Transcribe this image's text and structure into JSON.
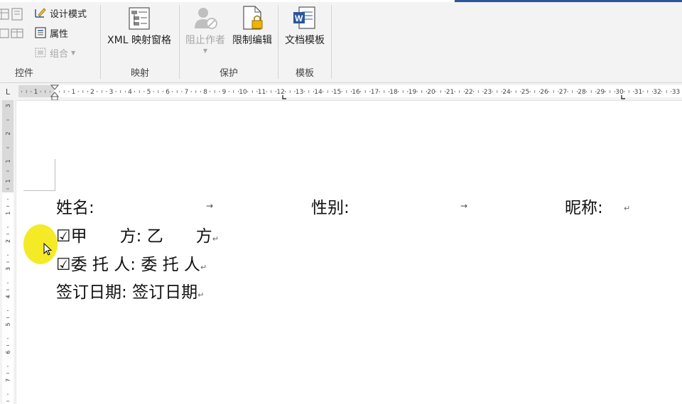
{
  "ribbon": {
    "groups": {
      "controls": {
        "label": "控件",
        "design_mode": "设计模式",
        "properties": "属性",
        "group": "组合"
      },
      "mapping": {
        "label": "映射",
        "xml_mapping_pane": "XML 映射窗格"
      },
      "protect": {
        "label": "保护",
        "block_authors": "阻止作者",
        "restrict_editing": "限制编辑"
      },
      "templates": {
        "label": "模板",
        "document_template": "文档模板"
      }
    }
  },
  "ruler": {
    "corner": "L",
    "h_numbers": [
      "1",
      "1",
      "2",
      "3",
      "4",
      "5",
      "6",
      "7",
      "8",
      "9",
      "10",
      "11",
      "12",
      "13",
      "14",
      "15",
      "16",
      "17",
      "18",
      "19",
      "20",
      "21",
      "22",
      "23",
      "24",
      "25",
      "26",
      "27",
      "28",
      "29",
      "30",
      "31",
      "32",
      "33"
    ],
    "v_numbers_top": [
      "3",
      "2",
      "1",
      "1"
    ],
    "v_numbers_body": [
      "1",
      "2",
      "3",
      "4",
      "5",
      "6",
      "7"
    ]
  },
  "document": {
    "line1": {
      "name_label": "姓名:",
      "gender_label": "性别:",
      "nickname_label": "昵称:"
    },
    "line2": {
      "checkbox": "☑",
      "left": "甲　　方:",
      "right": "乙　　方"
    },
    "line3": {
      "checkbox": "☑",
      "left": "委 托 人:",
      "right": "委 托 人"
    },
    "line4": {
      "left": "签订日期:",
      "right": "签订日期"
    },
    "tab_mark": "→",
    "return_mark": "↵"
  },
  "colors": {
    "accent": "#2b579a",
    "highlight": "#f3e600"
  }
}
